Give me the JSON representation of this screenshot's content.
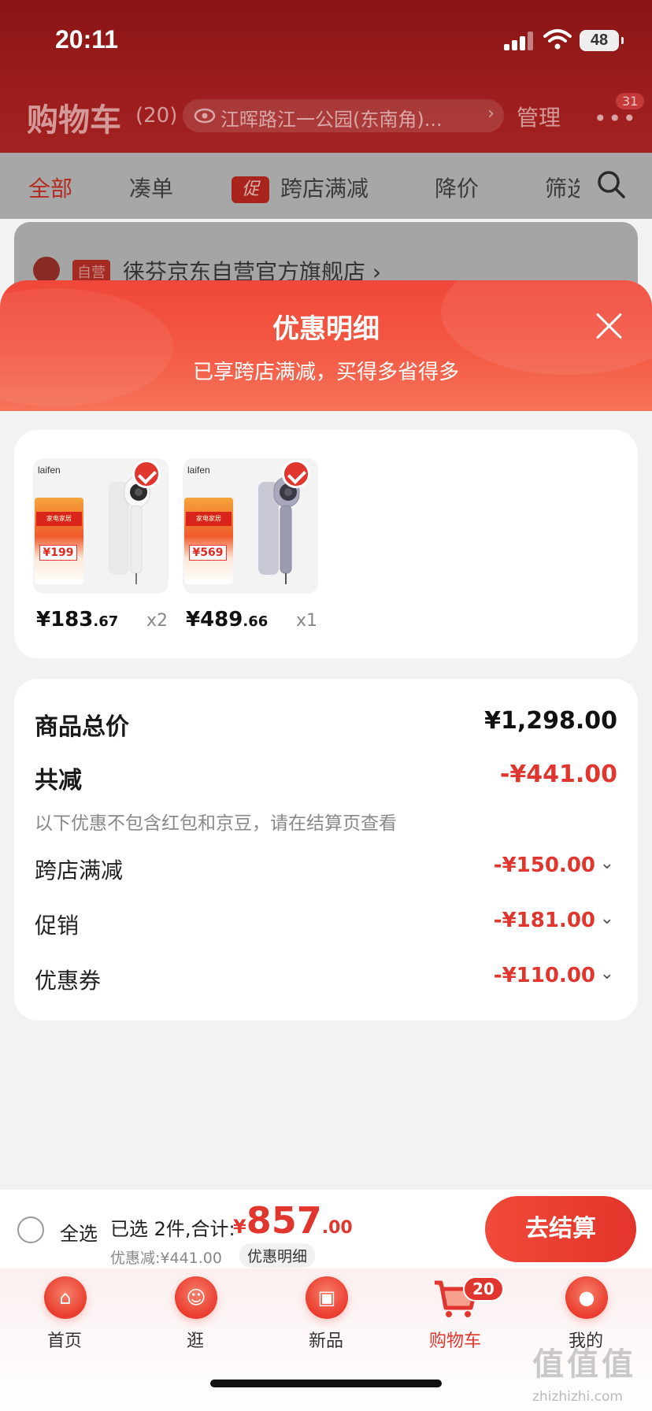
{
  "status_bar": {
    "time": "20:11",
    "battery": "48"
  },
  "header": {
    "title": "购物车",
    "count": "(20)",
    "address": "江晖路江一公园(东南角)...",
    "manage": "管理",
    "more_badge": "31"
  },
  "filter_tabs": [
    {
      "label": "全部"
    },
    {
      "label": "凑单"
    },
    {
      "promo_tag": "促",
      "label": "跨店满减"
    },
    {
      "label": "降价"
    },
    {
      "label": "筛选"
    }
  ],
  "store": {
    "self_tag": "自营",
    "name": "徕芬京东自营官方旗舰店 ›"
  },
  "sheet": {
    "title": "优惠明细",
    "subtitle": "已享跨店满减，买得多省得多"
  },
  "products": [
    {
      "brand": "laifen",
      "poster_price": "¥199",
      "price_int": "¥183",
      "price_dec": ".67",
      "qty": "x2",
      "color": "white"
    },
    {
      "brand": "laifen",
      "poster_price": "¥569",
      "price_int": "¥489",
      "price_dec": ".66",
      "qty": "x1",
      "color": "gray"
    }
  ],
  "summary": {
    "total_label": "商品总价",
    "total_value": "¥1,298.00",
    "reduce_label": "共减",
    "reduce_value": "-¥441.00",
    "note": "以下优惠不包含红包和京豆，请在结算页查看",
    "items": [
      {
        "label": "跨店满减",
        "value": "-¥150.00"
      },
      {
        "label": "促销",
        "value": "-¥181.00"
      },
      {
        "label": "优惠券",
        "value": "-¥110.00"
      }
    ]
  },
  "checkout": {
    "select_all": "全选",
    "selected_text": "已选 2件,合计:",
    "currency": "¥",
    "total_int": "857",
    "total_dec": ".00",
    "discount_text": "优惠减:¥441.00",
    "detail_link": "优惠明细",
    "button": "去结算"
  },
  "tabbar": [
    {
      "label": "首页",
      "icon": "home-icon"
    },
    {
      "label": "逛",
      "icon": "browse-icon"
    },
    {
      "label": "新品",
      "icon": "new-products-icon"
    },
    {
      "label": "购物车",
      "icon": "cart-icon",
      "badge": "20",
      "active": true
    },
    {
      "label": "我的",
      "icon": "profile-icon"
    }
  ],
  "watermark": {
    "big": "值值值",
    "small": "zhizhizhi.com"
  },
  "colors": {
    "accent": "#e0362d",
    "sheet_header": "#f0473a"
  }
}
